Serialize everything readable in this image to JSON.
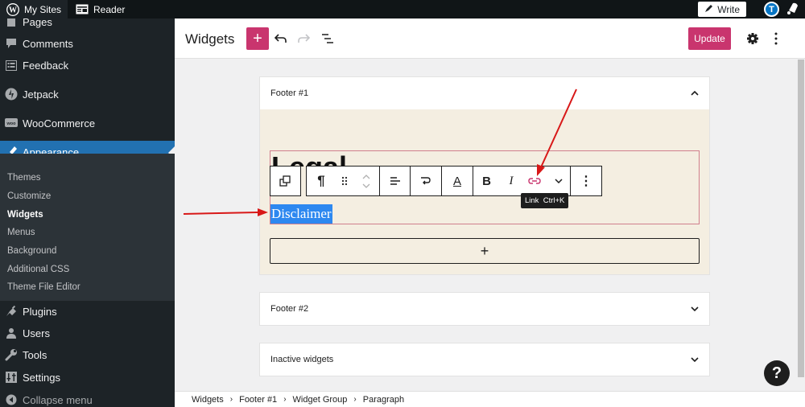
{
  "admin_bar": {
    "my_sites": "My Sites",
    "reader": "Reader",
    "write": "Write",
    "avatar_initial": "T"
  },
  "sidebar": {
    "items": [
      {
        "label": "Pages",
        "icon": "pages-icon"
      },
      {
        "label": "Comments",
        "icon": "comments-icon"
      },
      {
        "label": "Feedback",
        "icon": "feedback-icon"
      },
      {
        "label": "Jetpack",
        "icon": "jetpack-icon"
      },
      {
        "label": "WooCommerce",
        "icon": "woocommerce-icon"
      },
      {
        "label": "Appearance",
        "icon": "appearance-brush-icon",
        "active": true
      },
      {
        "label": "Plugins",
        "icon": "plugins-icon"
      },
      {
        "label": "Users",
        "icon": "users-icon"
      },
      {
        "label": "Tools",
        "icon": "tools-wrench-icon"
      },
      {
        "label": "Settings",
        "icon": "settings-sliders-icon"
      }
    ],
    "submenu": [
      {
        "label": "Themes"
      },
      {
        "label": "Customize"
      },
      {
        "label": "Widgets",
        "current": true
      },
      {
        "label": "Menus"
      },
      {
        "label": "Background"
      },
      {
        "label": "Additional CSS"
      },
      {
        "label": "Theme File Editor"
      }
    ],
    "collapse": "Collapse menu"
  },
  "header": {
    "title": "Widgets",
    "add_label": "+",
    "update_label": "Update"
  },
  "widget_areas": [
    {
      "title": "Footer #1",
      "expanded": true
    },
    {
      "title": "Footer #2",
      "expanded": false
    },
    {
      "title": "Inactive widgets",
      "expanded": false
    }
  ],
  "content": {
    "heading_text": "Legal",
    "selected_paragraph": "Disclaimer",
    "appender_label": "+"
  },
  "block_toolbar": {
    "paragraph_icon": "¶",
    "bold": "B",
    "italic": "I",
    "text_color": "A",
    "more": "⋮"
  },
  "tooltip": "Link  Ctrl+K",
  "breadcrumb": [
    "Widgets",
    "Footer #1",
    "Widget Group",
    "Paragraph"
  ],
  "help_label": "?",
  "colors": {
    "accent": "#c9356e",
    "admin_blue": "#2271b1",
    "selection": "#2d88f0",
    "annotation_arrow": "#d81818"
  }
}
